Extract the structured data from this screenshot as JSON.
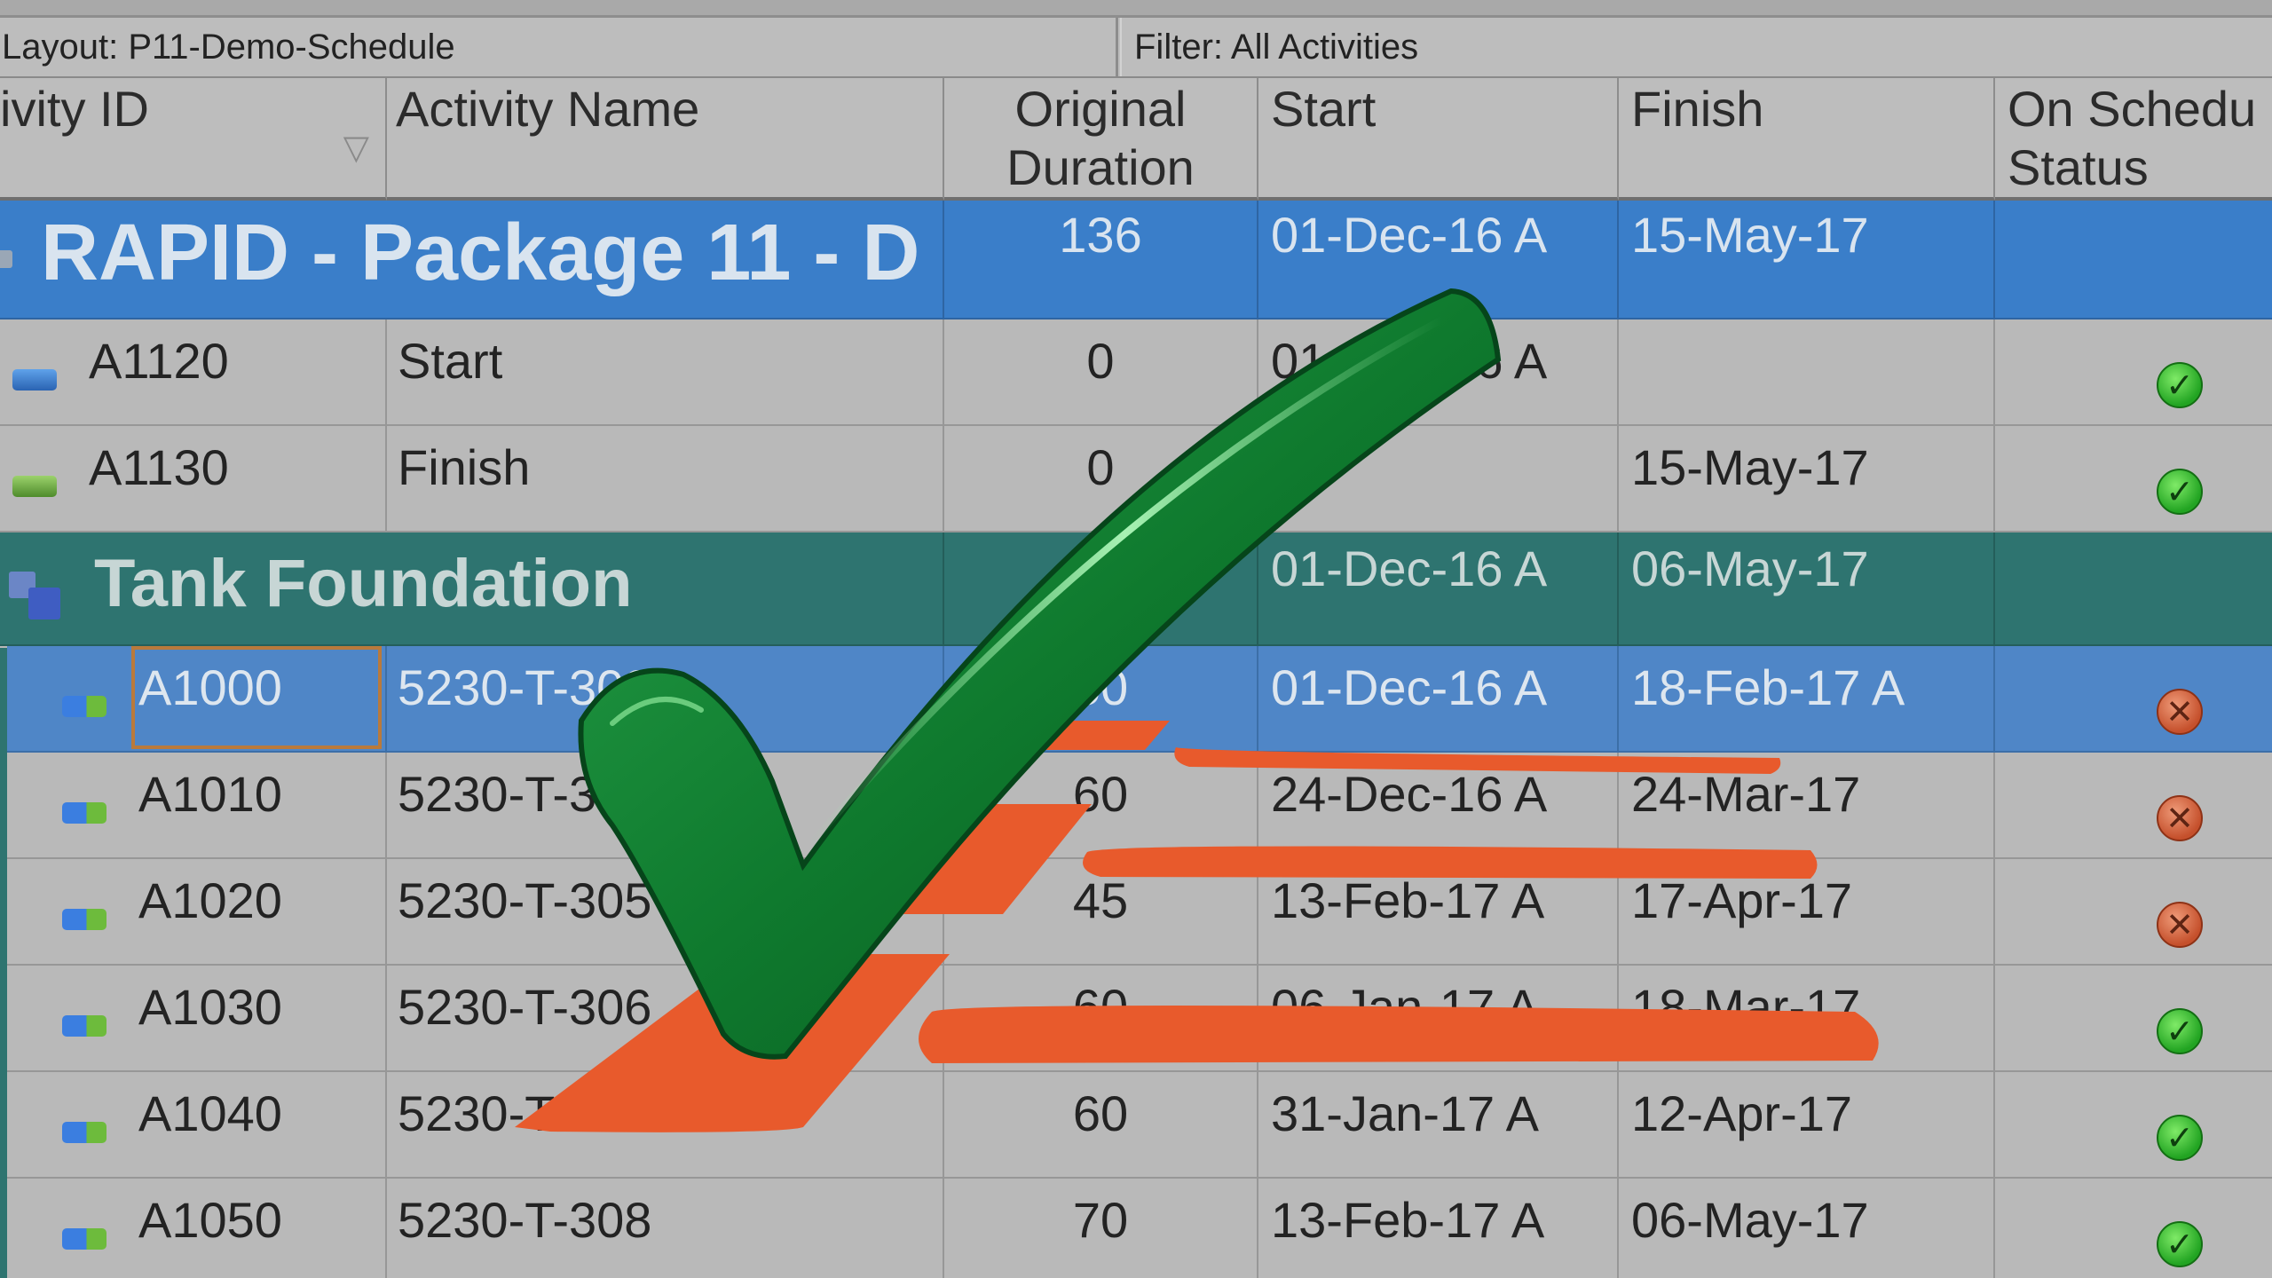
{
  "infobar": {
    "layout": "Layout: P11-Demo-Schedule",
    "filter": "Filter: All Activities"
  },
  "columns": {
    "activity_id": "ivity ID",
    "activity_name": "Activity Name",
    "original_duration_l1": "Original",
    "original_duration_l2": "Duration",
    "start": "Start",
    "finish": "Finish",
    "status_l1": "On Schedu",
    "status_l2": "Status"
  },
  "wbs_project": {
    "name": "RAPID - Package 11 - D",
    "duration": "136",
    "start": "01-Dec-16 A",
    "finish": "15-May-17"
  },
  "rows_top": [
    {
      "id": "A1120",
      "name": "Start",
      "duration": "0",
      "start": "01-Dec-16 A",
      "finish": "",
      "status": "ok",
      "icon": "start-milestone-icon"
    },
    {
      "id": "A1130",
      "name": "Finish",
      "duration": "0",
      "start": "",
      "finish": "15-May-17",
      "status": "ok",
      "icon": "finish-milestone-icon"
    }
  ],
  "wbs_tank": {
    "name": "Tank Foundation",
    "start": "01-Dec-16 A",
    "finish": "06-May-17"
  },
  "rows_tank": [
    {
      "id": "A1000",
      "name": "5230-T-303R",
      "duration": "50",
      "start": "01-Dec-16 A",
      "finish": "18-Feb-17 A",
      "status": "bad"
    },
    {
      "id": "A1010",
      "name": "5230-T-304",
      "duration": "60",
      "start": "24-Dec-16 A",
      "finish": "24-Mar-17",
      "status": "bad"
    },
    {
      "id": "A1020",
      "name": "5230-T-305",
      "duration": "45",
      "start": "13-Feb-17 A",
      "finish": "17-Apr-17",
      "status": "bad"
    },
    {
      "id": "A1030",
      "name": "5230-T-306",
      "duration": "60",
      "start": "06-Jan-17 A",
      "finish": "18-Mar-17",
      "status": "ok"
    },
    {
      "id": "A1040",
      "name": "5230-T-307",
      "duration": "60",
      "start": "31-Jan-17 A",
      "finish": "12-Apr-17",
      "status": "ok"
    },
    {
      "id": "A1050",
      "name": "5230-T-308",
      "duration": "70",
      "start": "13-Feb-17 A",
      "finish": "06-May-17",
      "status": "ok"
    }
  ],
  "colors": {
    "wbs_blue": "#3a7ec9",
    "wbs_teal": "#2e7470",
    "selected_row": "#4f86c7",
    "checkmark_green": "#0f7a2e",
    "strike_orange": "#e85a2c",
    "status_ok": "#22a422",
    "status_bad": "#c5502c"
  },
  "overlay": {
    "checkmark_icon": "checkmark-icon",
    "strike_icon": "orange-strikethrough-icon"
  }
}
